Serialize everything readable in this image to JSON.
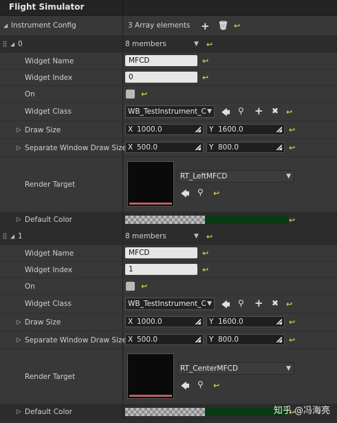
{
  "header": {
    "title": "Flight Simulator"
  },
  "instrument_config": {
    "label": "Instrument Config",
    "count_text": "3 Array elements",
    "add_icon": "plus-icon",
    "delete_icon": "trash-icon"
  },
  "elements": [
    {
      "index_label": "0",
      "members_text": "8 members",
      "widget_name": {
        "label": "Widget Name",
        "value": "MFCD"
      },
      "widget_index": {
        "label": "Widget Index",
        "value": "0"
      },
      "on": {
        "label": "On",
        "checked": false
      },
      "widget_class": {
        "label": "Widget Class",
        "value": "WB_TestInstrument_C"
      },
      "draw_size": {
        "label": "Draw Size",
        "x": "1000.0",
        "y": "1600.0"
      },
      "separate_window_draw_size": {
        "label": "Separate Window Draw Size",
        "x": "500.0",
        "y": "800.0"
      },
      "render_target": {
        "label": "Render Target",
        "value": "RT_LeftMFCD"
      },
      "default_color": {
        "label": "Default Color",
        "color": "#0a3a12"
      }
    },
    {
      "index_label": "1",
      "members_text": "8 members",
      "widget_name": {
        "label": "Widget Name",
        "value": "MFCD"
      },
      "widget_index": {
        "label": "Widget Index",
        "value": "1"
      },
      "on": {
        "label": "On",
        "checked": false
      },
      "widget_class": {
        "label": "Widget Class",
        "value": "WB_TestInstrument_C"
      },
      "draw_size": {
        "label": "Draw Size",
        "x": "1000.0",
        "y": "1600.0"
      },
      "separate_window_draw_size": {
        "label": "Separate Window Draw Size",
        "x": "500.0",
        "y": "800.0"
      },
      "render_target": {
        "label": "Render Target",
        "value": "RT_CenterMFCD"
      },
      "default_color": {
        "label": "Default Color",
        "color": "#0a3a12"
      }
    }
  ],
  "axis": {
    "x": "X",
    "y": "Y"
  },
  "watermark": "知乎 @冯海亮",
  "colors": {
    "reset_arrow": "#d9c44a",
    "panel_bg": "#2f2f2f",
    "row_bg": "#383838"
  }
}
